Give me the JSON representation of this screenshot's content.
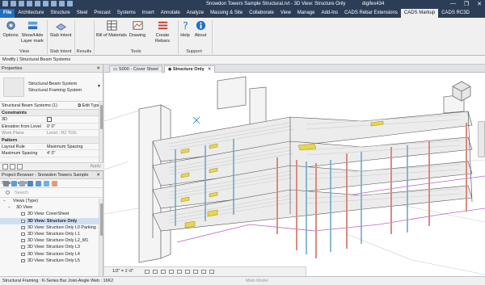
{
  "window": {
    "title": "Snowdon Towers Sample Structural.rvt - 3D View: Structure Only",
    "user": "digifex434",
    "buttons": [
      "—",
      "❐",
      "✕"
    ]
  },
  "ribbon_tabs": [
    "File",
    "Architecture",
    "Structure",
    "Steel",
    "Precast",
    "Systems",
    "Insert",
    "Annotate",
    "Analyze",
    "Massing & Site",
    "Collaborate",
    "View",
    "Manage",
    "Add-Ins",
    "CADS Rebar Extensions",
    "CADS Markup",
    "CADS RC3D"
  ],
  "active_tab": "CADS Markup",
  "ribbon": {
    "options": "Options",
    "show_hide_1": "Show/Hide",
    "show_hide_2": "Layer mark",
    "slab_intent": "Slab Intent",
    "bill_of_materials": "Bill of Materials",
    "drawing": "Drawing",
    "create_rebars": "Create Rebars",
    "help": "Help",
    "about": "About",
    "groups": {
      "view": "View",
      "slab_intent": "Slab Intent",
      "results": "Results",
      "tools": "Tools",
      "support": "Support"
    }
  },
  "modify_bar": "Modify | Structural Beam Systems",
  "properties": {
    "title": "Properties",
    "close": "✕",
    "type_line1": "Structural Beam System",
    "type_line2": "Structural Framing System",
    "filter": "Structural Beam Systems (1)",
    "edit_type": "Edit Type",
    "sections": [
      {
        "name": "Constraints",
        "rows": [
          {
            "k": "3D",
            "v": ""
          },
          {
            "k": "Elevation from Level",
            "v": "0' 0\""
          },
          {
            "k": "Work Plane",
            "v": "Level : R2 TOS",
            "muted": true
          }
        ]
      },
      {
        "name": "Pattern",
        "rows": [
          {
            "k": "Layout Rule",
            "v": "Maximum Spacing"
          },
          {
            "k": "Maximum Spacing",
            "v": "4' 0\""
          }
        ]
      }
    ],
    "apply": "Apply"
  },
  "project_browser": {
    "title": "Project Browser - Snowdon Towers Sample Structural.rvt",
    "close": "✕",
    "search_placeholder": "Search",
    "items": [
      {
        "label": "Views (Type)",
        "level": 0,
        "expand": "−"
      },
      {
        "label": "3D View",
        "level": 1,
        "expand": "−"
      },
      {
        "label": "3D View: CoverSheet",
        "level": 2
      },
      {
        "label": "3D View: Structure Only",
        "level": 2,
        "selected": true
      },
      {
        "label": "3D View: Structure Only L0 Parking",
        "level": 2
      },
      {
        "label": "3D View: Structure Only L1",
        "level": 2
      },
      {
        "label": "3D View: Structure Only L2_M1",
        "level": 2
      },
      {
        "label": "3D View: Structure Only L3",
        "level": 2
      },
      {
        "label": "3D View: Structure Only L4",
        "level": 2
      },
      {
        "label": "3D View: Structure Only L5",
        "level": 2
      }
    ]
  },
  "view_tabs": [
    {
      "label": "S000 - Cover Sheet",
      "active": false
    },
    {
      "label": "Structure Only",
      "active": true
    }
  ],
  "view_control": {
    "scale": "1/2\" = 1'-0\""
  },
  "status": {
    "text": "Structural Framing : K-Series Bar Joist-Angle Web : 16K2",
    "model": "Main Model"
  },
  "colors": {
    "accent_blue": "#1f6fc4",
    "column_steel": "#d98b7e",
    "brace_blue": "#6fa8c8",
    "joist_yellow": "#e8d74a",
    "ground_line": "#c060c8"
  }
}
